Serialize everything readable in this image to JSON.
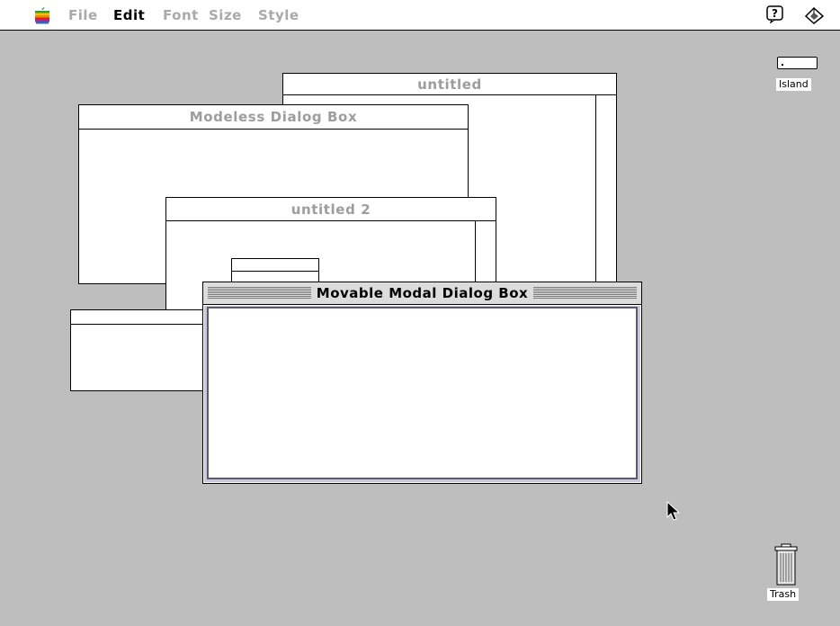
{
  "menubar": {
    "items": [
      {
        "label": "File",
        "enabled": false
      },
      {
        "label": "Edit",
        "enabled": true
      },
      {
        "label": "Font",
        "enabled": false
      },
      {
        "label": "Size",
        "enabled": false
      },
      {
        "label": "Style",
        "enabled": false
      }
    ],
    "icons": [
      "apple-icon",
      "help-icon",
      "application-menu-icon"
    ]
  },
  "windows": {
    "untitled": {
      "title": "untitled"
    },
    "modeless": {
      "title": "Modeless Dialog Box"
    },
    "untitled2": {
      "title": "untitled 2"
    },
    "modal": {
      "title": "Movable Modal Dialog Box"
    }
  },
  "desktop": {
    "island": {
      "label": "Island"
    },
    "trash": {
      "label": "Trash"
    }
  },
  "colors": {
    "desktop": "#bebebe",
    "inactive_title": "#9d9d9d",
    "modal_title_bg": "#dcdcdc"
  }
}
